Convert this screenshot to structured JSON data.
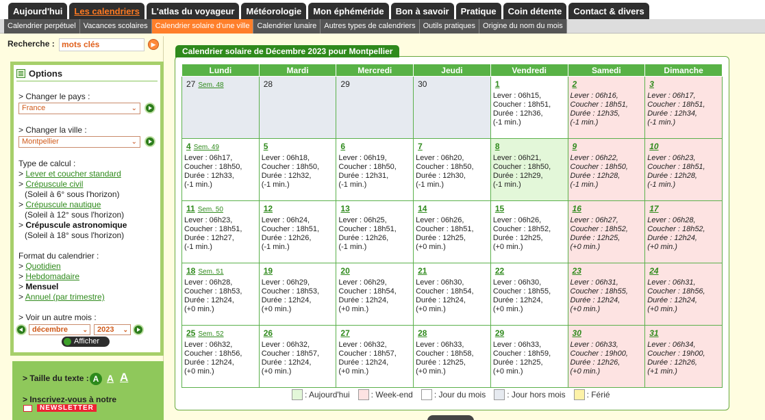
{
  "top_tabs": [
    {
      "label": "Aujourd'hui",
      "active": false
    },
    {
      "label": "Les calendriers",
      "active": true
    },
    {
      "label": "L'atlas du voyageur",
      "active": false
    },
    {
      "label": "Météorologie",
      "active": false
    },
    {
      "label": "Mon éphéméride",
      "active": false
    },
    {
      "label": "Bon à savoir",
      "active": false
    },
    {
      "label": "Pratique",
      "active": false
    },
    {
      "label": "Coin détente",
      "active": false
    },
    {
      "label": "Contact & divers",
      "active": false
    }
  ],
  "sub_tabs": [
    {
      "label": "Calendrier perpétuel",
      "active": false
    },
    {
      "label": "Vacances scolaires",
      "active": false
    },
    {
      "label": "Calendrier solaire d'une ville",
      "active": true
    },
    {
      "label": "Calendrier lunaire",
      "active": false
    },
    {
      "label": "Autres types de calendriers",
      "active": false
    },
    {
      "label": "Outils pratiques",
      "active": false
    },
    {
      "label": "Origine du nom du mois",
      "active": false
    }
  ],
  "search": {
    "label": "Recherche :",
    "placeholder": "mots clés"
  },
  "options": {
    "title": "Options",
    "country_label": "> Changer le pays :",
    "country_value": "France",
    "city_label": "> Changer la ville :",
    "city_value": "Montpellier",
    "calc_label": "Type de calcul :",
    "calc_items": [
      {
        "label": "Lever et coucher standard",
        "link": true,
        "note": ""
      },
      {
        "label": "Crépuscule civil",
        "link": true,
        "note": "(Soleil à 6° sous l'horizon)"
      },
      {
        "label": "Crépuscule nautique",
        "link": true,
        "note": "(Soleil à 12° sous l'horizon)"
      },
      {
        "label": "Crépuscule astronomique",
        "link": false,
        "note": "(Soleil à 18° sous l'horizon)"
      }
    ],
    "format_label": "Format du calendrier :",
    "format_items": [
      {
        "label": "Quotidien",
        "link": true
      },
      {
        "label": "Hebdomadaire",
        "link": true
      },
      {
        "label": "Mensuel",
        "link": false
      },
      {
        "label": "Annuel (par trimestre)",
        "link": true
      }
    ],
    "month_label": "> Voir un autre mois :",
    "month_value": "décembre",
    "year_value": "2023",
    "show_button": "Afficher"
  },
  "textsize": {
    "label": "> Taille du texte :",
    "a": "A",
    "newsletter_label": "> Inscrivez-vous à notre",
    "newsletter": "NEWSLETTER"
  },
  "calendar": {
    "title": "Calendrier solaire de Décembre 2023 pour Montpellier",
    "weekdays": [
      "Lundi",
      "Mardi",
      "Mercredi",
      "Jeudi",
      "Vendredi",
      "Samedi",
      "Dimanche"
    ],
    "weeks": [
      [
        {
          "d": "27",
          "wk": "Sem. 48",
          "type": "out",
          "lines": []
        },
        {
          "d": "28",
          "wk": "",
          "type": "out",
          "lines": []
        },
        {
          "d": "29",
          "wk": "",
          "type": "out",
          "lines": []
        },
        {
          "d": "30",
          "wk": "",
          "type": "out",
          "lines": []
        },
        {
          "d": "1",
          "wk": "",
          "type": "day",
          "lines": [
            "Lever : 06h15,",
            "Coucher : 18h51,",
            "Durée : 12h36,",
            "(-1 min.)"
          ]
        },
        {
          "d": "2",
          "wk": "",
          "type": "weekend",
          "lines": [
            "Lever : 06h16,",
            "Coucher : 18h51,",
            "Durée : 12h35,",
            "(-1 min.)"
          ]
        },
        {
          "d": "3",
          "wk": "",
          "type": "weekend",
          "lines": [
            "Lever : 06h17,",
            "Coucher : 18h51,",
            "Durée : 12h34,",
            "(-1 min.)"
          ]
        }
      ],
      [
        {
          "d": "4",
          "wk": "Sem. 49",
          "type": "day",
          "lines": [
            "Lever : 06h17,",
            "Coucher : 18h50,",
            "Durée : 12h33,",
            "(-1 min.)"
          ]
        },
        {
          "d": "5",
          "wk": "",
          "type": "day",
          "lines": [
            "Lever : 06h18,",
            "Coucher : 18h50,",
            "Durée : 12h32,",
            "(-1 min.)"
          ]
        },
        {
          "d": "6",
          "wk": "",
          "type": "day",
          "lines": [
            "Lever : 06h19,",
            "Coucher : 18h50,",
            "Durée : 12h31,",
            "(-1 min.)"
          ]
        },
        {
          "d": "7",
          "wk": "",
          "type": "day",
          "lines": [
            "Lever : 06h20,",
            "Coucher : 18h50,",
            "Durée : 12h30,",
            "(-1 min.)"
          ]
        },
        {
          "d": "8",
          "wk": "",
          "type": "today",
          "lines": [
            "Lever : 06h21,",
            "Coucher : 18h50,",
            "Durée : 12h29,",
            "(-1 min.)"
          ]
        },
        {
          "d": "9",
          "wk": "",
          "type": "weekend",
          "lines": [
            "Lever : 06h22,",
            "Coucher : 18h50,",
            "Durée : 12h28,",
            "(-1 min.)"
          ]
        },
        {
          "d": "10",
          "wk": "",
          "type": "weekend",
          "lines": [
            "Lever : 06h23,",
            "Coucher : 18h51,",
            "Durée : 12h28,",
            "(-1 min.)"
          ]
        }
      ],
      [
        {
          "d": "11",
          "wk": "Sem. 50",
          "type": "day",
          "lines": [
            "Lever : 06h23,",
            "Coucher : 18h51,",
            "Durée : 12h27,",
            "(-1 min.)"
          ]
        },
        {
          "d": "12",
          "wk": "",
          "type": "day",
          "lines": [
            "Lever : 06h24,",
            "Coucher : 18h51,",
            "Durée : 12h26,",
            "(-1 min.)"
          ]
        },
        {
          "d": "13",
          "wk": "",
          "type": "day",
          "lines": [
            "Lever : 06h25,",
            "Coucher : 18h51,",
            "Durée : 12h26,",
            "(-1 min.)"
          ]
        },
        {
          "d": "14",
          "wk": "",
          "type": "day",
          "lines": [
            "Lever : 06h26,",
            "Coucher : 18h51,",
            "Durée : 12h25,",
            "(+0 min.)"
          ]
        },
        {
          "d": "15",
          "wk": "",
          "type": "day",
          "lines": [
            "Lever : 06h26,",
            "Coucher : 18h52,",
            "Durée : 12h25,",
            "(+0 min.)"
          ]
        },
        {
          "d": "16",
          "wk": "",
          "type": "weekend",
          "lines": [
            "Lever : 06h27,",
            "Coucher : 18h52,",
            "Durée : 12h25,",
            "(+0 min.)"
          ]
        },
        {
          "d": "17",
          "wk": "",
          "type": "weekend",
          "lines": [
            "Lever : 06h28,",
            "Coucher : 18h52,",
            "Durée : 12h24,",
            "(+0 min.)"
          ]
        }
      ],
      [
        {
          "d": "18",
          "wk": "Sem. 51",
          "type": "day",
          "lines": [
            "Lever : 06h28,",
            "Coucher : 18h53,",
            "Durée : 12h24,",
            "(+0 min.)"
          ]
        },
        {
          "d": "19",
          "wk": "",
          "type": "day",
          "lines": [
            "Lever : 06h29,",
            "Coucher : 18h53,",
            "Durée : 12h24,",
            "(+0 min.)"
          ]
        },
        {
          "d": "20",
          "wk": "",
          "type": "day",
          "lines": [
            "Lever : 06h29,",
            "Coucher : 18h54,",
            "Durée : 12h24,",
            "(+0 min.)"
          ]
        },
        {
          "d": "21",
          "wk": "",
          "type": "day",
          "lines": [
            "Lever : 06h30,",
            "Coucher : 18h54,",
            "Durée : 12h24,",
            "(+0 min.)"
          ]
        },
        {
          "d": "22",
          "wk": "",
          "type": "day",
          "lines": [
            "Lever : 06h30,",
            "Coucher : 18h55,",
            "Durée : 12h24,",
            "(+0 min.)"
          ]
        },
        {
          "d": "23",
          "wk": "",
          "type": "weekend",
          "lines": [
            "Lever : 06h31,",
            "Coucher : 18h55,",
            "Durée : 12h24,",
            "(+0 min.)"
          ]
        },
        {
          "d": "24",
          "wk": "",
          "type": "weekend",
          "lines": [
            "Lever : 06h31,",
            "Coucher : 18h56,",
            "Durée : 12h24,",
            "(+0 min.)"
          ]
        }
      ],
      [
        {
          "d": "25",
          "wk": "Sem. 52",
          "type": "day",
          "lines": [
            "Lever : 06h32,",
            "Coucher : 18h56,",
            "Durée : 12h24,",
            "(+0 min.)"
          ]
        },
        {
          "d": "26",
          "wk": "",
          "type": "day",
          "lines": [
            "Lever : 06h32,",
            "Coucher : 18h57,",
            "Durée : 12h24,",
            "(+0 min.)"
          ]
        },
        {
          "d": "27",
          "wk": "",
          "type": "day",
          "lines": [
            "Lever : 06h32,",
            "Coucher : 18h57,",
            "Durée : 12h24,",
            "(+0 min.)"
          ]
        },
        {
          "d": "28",
          "wk": "",
          "type": "day",
          "lines": [
            "Lever : 06h33,",
            "Coucher : 18h58,",
            "Durée : 12h25,",
            "(+0 min.)"
          ]
        },
        {
          "d": "29",
          "wk": "",
          "type": "day",
          "lines": [
            "Lever : 06h33,",
            "Coucher : 18h59,",
            "Durée : 12h25,",
            "(+0 min.)"
          ]
        },
        {
          "d": "30",
          "wk": "",
          "type": "weekend",
          "lines": [
            "Lever : 06h33,",
            "Coucher : 19h00,",
            "Durée : 12h26,",
            "(+0 min.)"
          ]
        },
        {
          "d": "31",
          "wk": "",
          "type": "weekend",
          "lines": [
            "Lever : 06h34,",
            "Coucher : 19h00,",
            "Durée : 12h26,",
            "(+1 min.)"
          ]
        }
      ]
    ],
    "legend": [
      {
        "label": ": Aujourd'hui",
        "color": "#e3f7d9"
      },
      {
        "label": ": Week-end",
        "color": "#fde3e2"
      },
      {
        "label": ": Jour du mois",
        "color": "#ffffff"
      },
      {
        "label": ": Jour hors mois",
        "color": "#e6eaf0"
      },
      {
        "label": ": Férié",
        "color": "#fdf2a8"
      }
    ]
  }
}
